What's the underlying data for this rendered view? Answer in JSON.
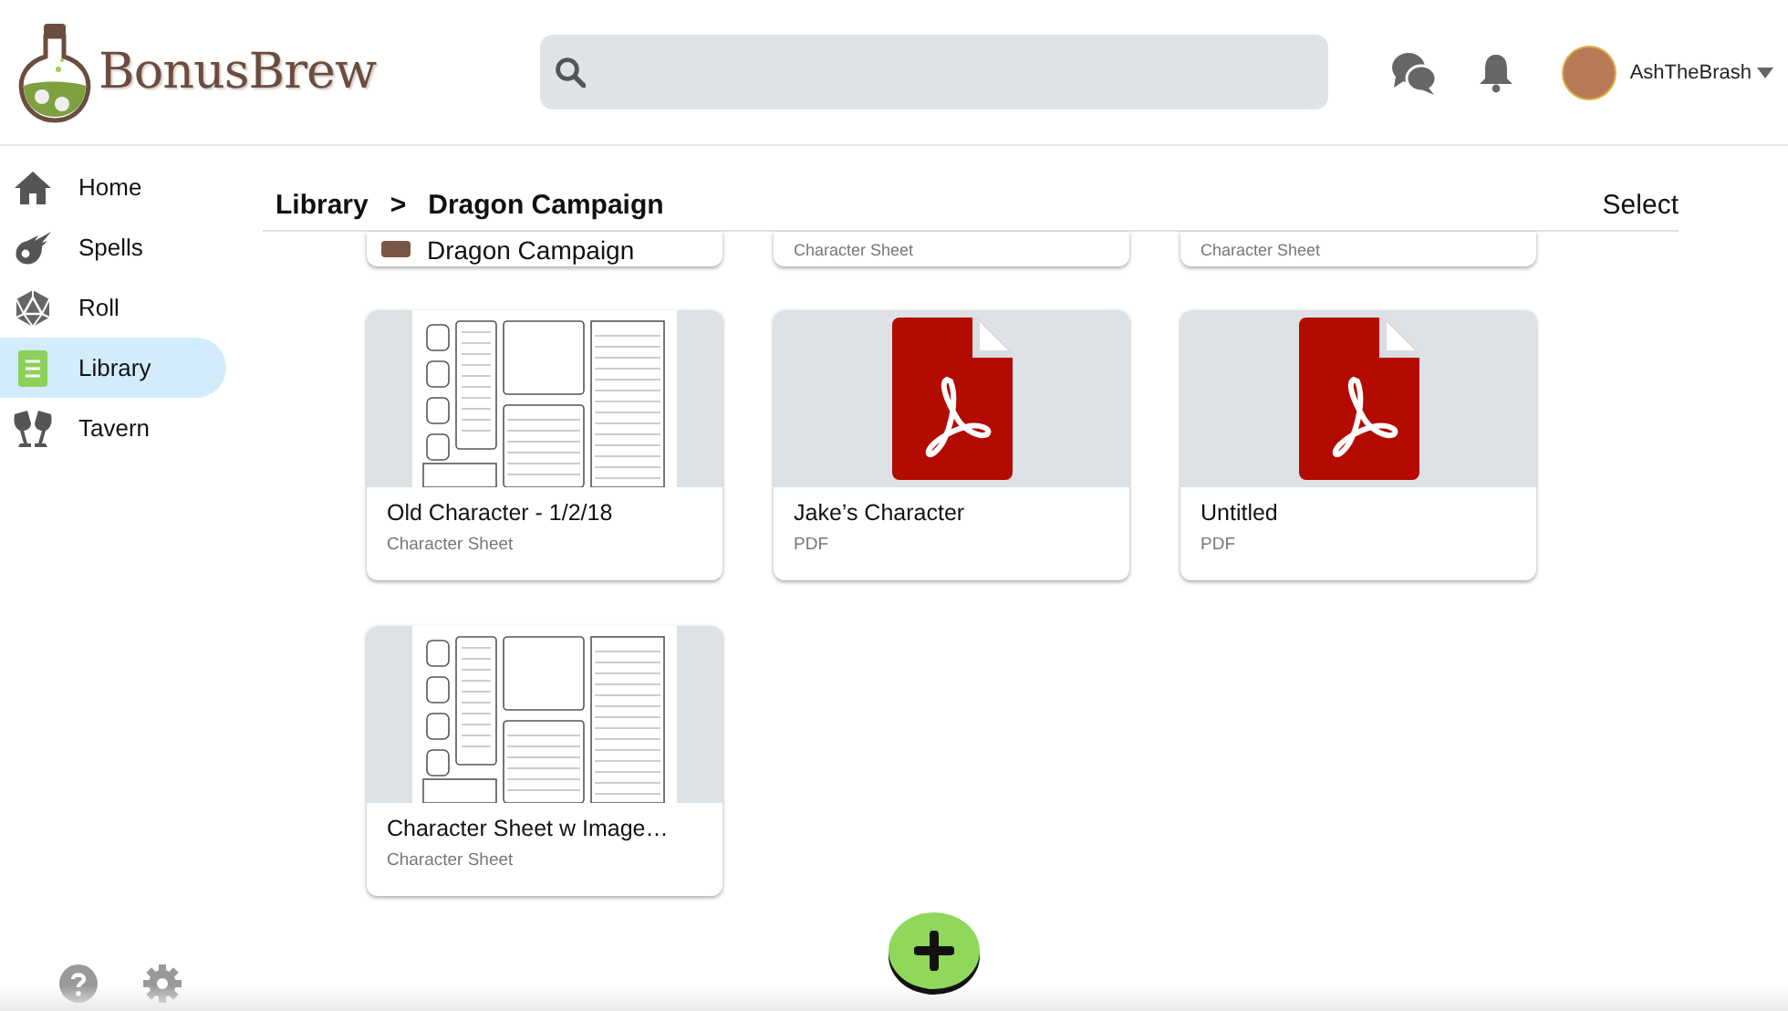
{
  "brand": {
    "name": "BonusBrew"
  },
  "user": {
    "name": "AshTheBrash"
  },
  "sidebar": {
    "items": [
      {
        "label": "Home",
        "selected": false
      },
      {
        "label": "Spells",
        "selected": false
      },
      {
        "label": "Roll",
        "selected": false
      },
      {
        "label": "Library",
        "selected": true
      },
      {
        "label": "Tavern",
        "selected": false
      }
    ]
  },
  "breadcrumb": {
    "parts": [
      "Library",
      "Dragon Campaign"
    ],
    "separator": ">"
  },
  "select_label": "Select",
  "partial_row": [
    {
      "kind": "folder",
      "text": "Dragon Campaign"
    },
    {
      "kind": "file",
      "text": "Character Sheet"
    },
    {
      "kind": "file",
      "text": "Character Sheet"
    }
  ],
  "cards": [
    {
      "kind": "sheet",
      "title": "Old Character - 1/2/18",
      "type": "Character Sheet"
    },
    {
      "kind": "pdf",
      "title": "Jake’s Character",
      "type": "PDF"
    },
    {
      "kind": "pdf",
      "title": "Untitled",
      "type": "PDF"
    },
    {
      "kind": "sheet",
      "title": "Character Sheet w Image…",
      "type": "Character Sheet"
    }
  ]
}
